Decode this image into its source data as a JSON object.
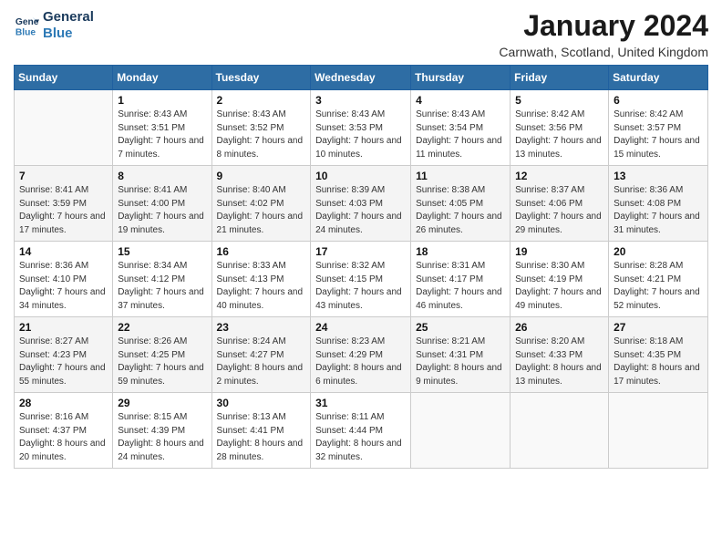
{
  "logo": {
    "line1": "General",
    "line2": "Blue"
  },
  "title": "January 2024",
  "subtitle": "Carnwath, Scotland, United Kingdom",
  "days_of_week": [
    "Sunday",
    "Monday",
    "Tuesday",
    "Wednesday",
    "Thursday",
    "Friday",
    "Saturday"
  ],
  "weeks": [
    [
      {
        "day": "",
        "sunrise": "",
        "sunset": "",
        "daylight": ""
      },
      {
        "day": "1",
        "sunrise": "Sunrise: 8:43 AM",
        "sunset": "Sunset: 3:51 PM",
        "daylight": "Daylight: 7 hours and 7 minutes."
      },
      {
        "day": "2",
        "sunrise": "Sunrise: 8:43 AM",
        "sunset": "Sunset: 3:52 PM",
        "daylight": "Daylight: 7 hours and 8 minutes."
      },
      {
        "day": "3",
        "sunrise": "Sunrise: 8:43 AM",
        "sunset": "Sunset: 3:53 PM",
        "daylight": "Daylight: 7 hours and 10 minutes."
      },
      {
        "day": "4",
        "sunrise": "Sunrise: 8:43 AM",
        "sunset": "Sunset: 3:54 PM",
        "daylight": "Daylight: 7 hours and 11 minutes."
      },
      {
        "day": "5",
        "sunrise": "Sunrise: 8:42 AM",
        "sunset": "Sunset: 3:56 PM",
        "daylight": "Daylight: 7 hours and 13 minutes."
      },
      {
        "day": "6",
        "sunrise": "Sunrise: 8:42 AM",
        "sunset": "Sunset: 3:57 PM",
        "daylight": "Daylight: 7 hours and 15 minutes."
      }
    ],
    [
      {
        "day": "7",
        "sunrise": "Sunrise: 8:41 AM",
        "sunset": "Sunset: 3:59 PM",
        "daylight": "Daylight: 7 hours and 17 minutes."
      },
      {
        "day": "8",
        "sunrise": "Sunrise: 8:41 AM",
        "sunset": "Sunset: 4:00 PM",
        "daylight": "Daylight: 7 hours and 19 minutes."
      },
      {
        "day": "9",
        "sunrise": "Sunrise: 8:40 AM",
        "sunset": "Sunset: 4:02 PM",
        "daylight": "Daylight: 7 hours and 21 minutes."
      },
      {
        "day": "10",
        "sunrise": "Sunrise: 8:39 AM",
        "sunset": "Sunset: 4:03 PM",
        "daylight": "Daylight: 7 hours and 24 minutes."
      },
      {
        "day": "11",
        "sunrise": "Sunrise: 8:38 AM",
        "sunset": "Sunset: 4:05 PM",
        "daylight": "Daylight: 7 hours and 26 minutes."
      },
      {
        "day": "12",
        "sunrise": "Sunrise: 8:37 AM",
        "sunset": "Sunset: 4:06 PM",
        "daylight": "Daylight: 7 hours and 29 minutes."
      },
      {
        "day": "13",
        "sunrise": "Sunrise: 8:36 AM",
        "sunset": "Sunset: 4:08 PM",
        "daylight": "Daylight: 7 hours and 31 minutes."
      }
    ],
    [
      {
        "day": "14",
        "sunrise": "Sunrise: 8:36 AM",
        "sunset": "Sunset: 4:10 PM",
        "daylight": "Daylight: 7 hours and 34 minutes."
      },
      {
        "day": "15",
        "sunrise": "Sunrise: 8:34 AM",
        "sunset": "Sunset: 4:12 PM",
        "daylight": "Daylight: 7 hours and 37 minutes."
      },
      {
        "day": "16",
        "sunrise": "Sunrise: 8:33 AM",
        "sunset": "Sunset: 4:13 PM",
        "daylight": "Daylight: 7 hours and 40 minutes."
      },
      {
        "day": "17",
        "sunrise": "Sunrise: 8:32 AM",
        "sunset": "Sunset: 4:15 PM",
        "daylight": "Daylight: 7 hours and 43 minutes."
      },
      {
        "day": "18",
        "sunrise": "Sunrise: 8:31 AM",
        "sunset": "Sunset: 4:17 PM",
        "daylight": "Daylight: 7 hours and 46 minutes."
      },
      {
        "day": "19",
        "sunrise": "Sunrise: 8:30 AM",
        "sunset": "Sunset: 4:19 PM",
        "daylight": "Daylight: 7 hours and 49 minutes."
      },
      {
        "day": "20",
        "sunrise": "Sunrise: 8:28 AM",
        "sunset": "Sunset: 4:21 PM",
        "daylight": "Daylight: 7 hours and 52 minutes."
      }
    ],
    [
      {
        "day": "21",
        "sunrise": "Sunrise: 8:27 AM",
        "sunset": "Sunset: 4:23 PM",
        "daylight": "Daylight: 7 hours and 55 minutes."
      },
      {
        "day": "22",
        "sunrise": "Sunrise: 8:26 AM",
        "sunset": "Sunset: 4:25 PM",
        "daylight": "Daylight: 7 hours and 59 minutes."
      },
      {
        "day": "23",
        "sunrise": "Sunrise: 8:24 AM",
        "sunset": "Sunset: 4:27 PM",
        "daylight": "Daylight: 8 hours and 2 minutes."
      },
      {
        "day": "24",
        "sunrise": "Sunrise: 8:23 AM",
        "sunset": "Sunset: 4:29 PM",
        "daylight": "Daylight: 8 hours and 6 minutes."
      },
      {
        "day": "25",
        "sunrise": "Sunrise: 8:21 AM",
        "sunset": "Sunset: 4:31 PM",
        "daylight": "Daylight: 8 hours and 9 minutes."
      },
      {
        "day": "26",
        "sunrise": "Sunrise: 8:20 AM",
        "sunset": "Sunset: 4:33 PM",
        "daylight": "Daylight: 8 hours and 13 minutes."
      },
      {
        "day": "27",
        "sunrise": "Sunrise: 8:18 AM",
        "sunset": "Sunset: 4:35 PM",
        "daylight": "Daylight: 8 hours and 17 minutes."
      }
    ],
    [
      {
        "day": "28",
        "sunrise": "Sunrise: 8:16 AM",
        "sunset": "Sunset: 4:37 PM",
        "daylight": "Daylight: 8 hours and 20 minutes."
      },
      {
        "day": "29",
        "sunrise": "Sunrise: 8:15 AM",
        "sunset": "Sunset: 4:39 PM",
        "daylight": "Daylight: 8 hours and 24 minutes."
      },
      {
        "day": "30",
        "sunrise": "Sunrise: 8:13 AM",
        "sunset": "Sunset: 4:41 PM",
        "daylight": "Daylight: 8 hours and 28 minutes."
      },
      {
        "day": "31",
        "sunrise": "Sunrise: 8:11 AM",
        "sunset": "Sunset: 4:44 PM",
        "daylight": "Daylight: 8 hours and 32 minutes."
      },
      {
        "day": "",
        "sunrise": "",
        "sunset": "",
        "daylight": ""
      },
      {
        "day": "",
        "sunrise": "",
        "sunset": "",
        "daylight": ""
      },
      {
        "day": "",
        "sunrise": "",
        "sunset": "",
        "daylight": ""
      }
    ]
  ]
}
